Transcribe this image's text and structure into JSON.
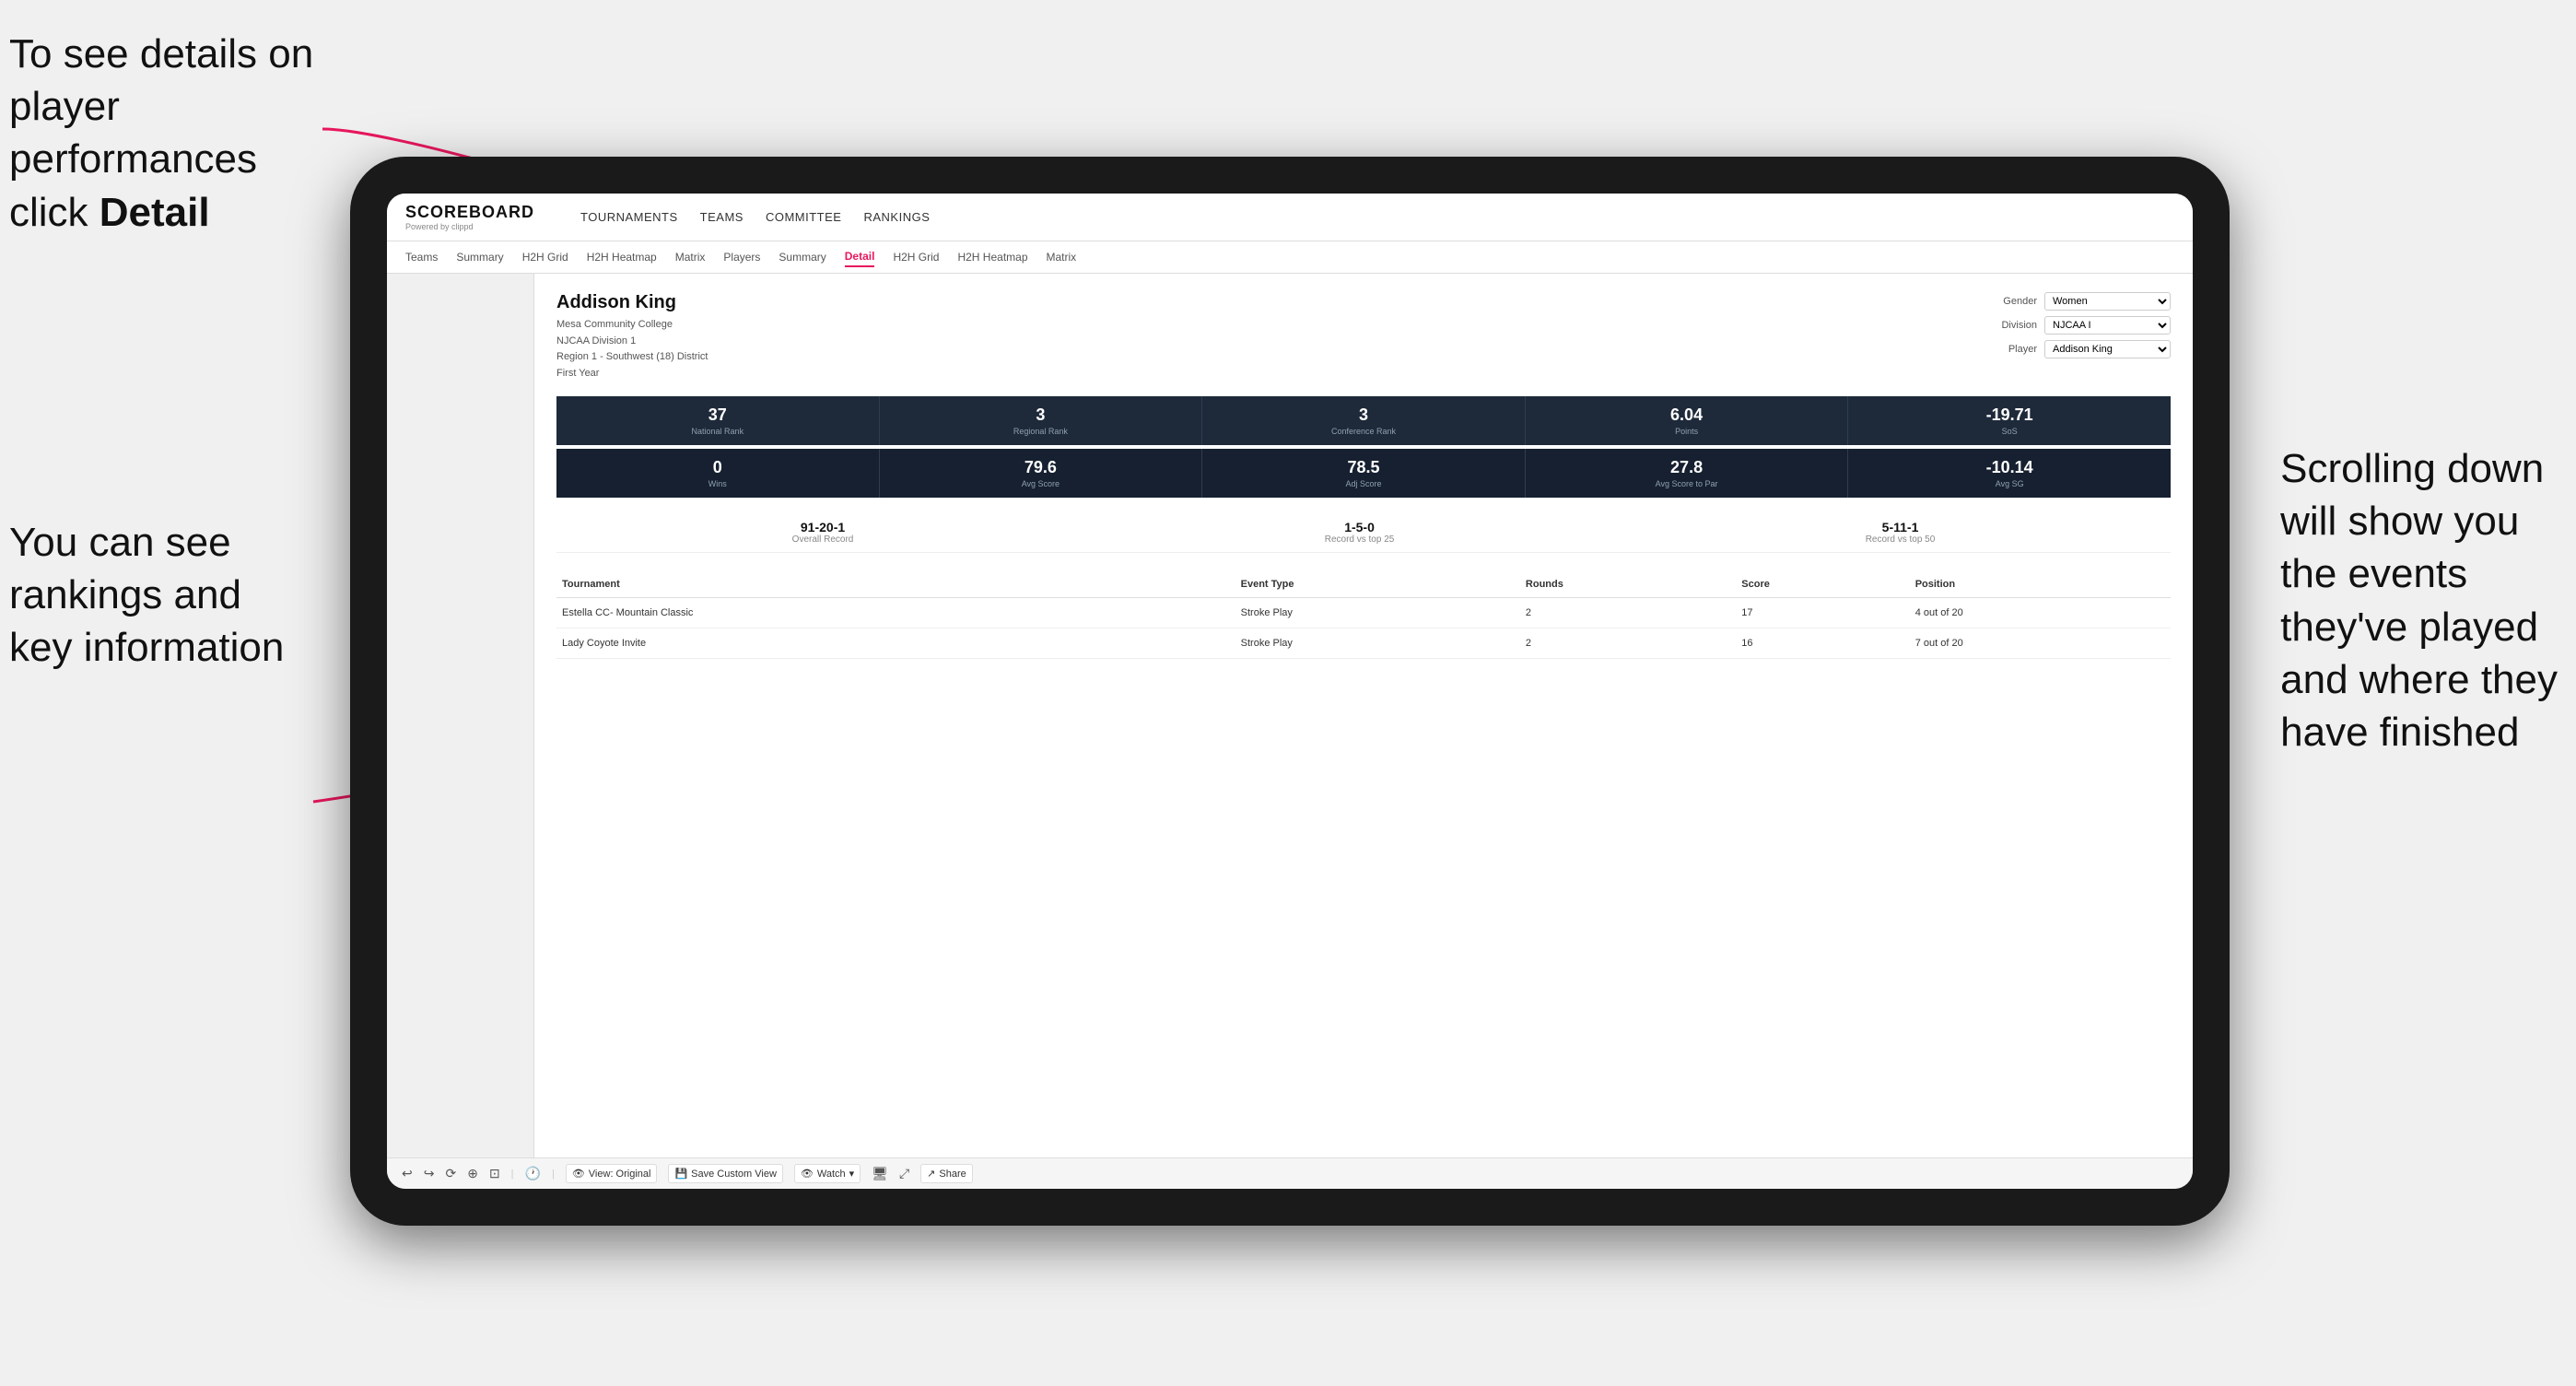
{
  "annotations": {
    "top_left": "To see details on player performances click ",
    "top_left_bold": "Detail",
    "bottom_left_line1": "You can see",
    "bottom_left_line2": "rankings and",
    "bottom_left_line3": "key information",
    "right_line1": "Scrolling down",
    "right_line2": "will show you",
    "right_line3": "the events",
    "right_line4": "they've played",
    "right_line5": "and where they",
    "right_line6": "have finished"
  },
  "header": {
    "logo_title": "SCOREBOARD",
    "logo_sub": "Powered by clippd",
    "nav_items": [
      {
        "label": "TOURNAMENTS",
        "active": false
      },
      {
        "label": "TEAMS",
        "active": false
      },
      {
        "label": "COMMITTEE",
        "active": false
      },
      {
        "label": "RANKINGS",
        "active": false
      }
    ]
  },
  "sub_nav": {
    "items": [
      {
        "label": "Teams",
        "active": false
      },
      {
        "label": "Summary",
        "active": false
      },
      {
        "label": "H2H Grid",
        "active": false
      },
      {
        "label": "H2H Heatmap",
        "active": false
      },
      {
        "label": "Matrix",
        "active": false
      },
      {
        "label": "Players",
        "active": false
      },
      {
        "label": "Summary",
        "active": false
      },
      {
        "label": "Detail",
        "active": true
      },
      {
        "label": "H2H Grid",
        "active": false
      },
      {
        "label": "H2H Heatmap",
        "active": false
      },
      {
        "label": "Matrix",
        "active": false
      }
    ]
  },
  "player": {
    "name": "Addison King",
    "school": "Mesa Community College",
    "division": "NJCAA Division 1",
    "region": "Region 1 - Southwest (18) District",
    "year": "First Year"
  },
  "controls": {
    "gender_label": "Gender",
    "gender_value": "Women",
    "division_label": "Division",
    "division_value": "NJCAA I",
    "player_label": "Player",
    "player_value": "Addison King"
  },
  "stats_row1": [
    {
      "value": "37",
      "label": "National Rank"
    },
    {
      "value": "3",
      "label": "Regional Rank"
    },
    {
      "value": "3",
      "label": "Conference Rank"
    },
    {
      "value": "6.04",
      "label": "Points"
    },
    {
      "value": "-19.71",
      "label": "SoS"
    }
  ],
  "stats_row2": [
    {
      "value": "0",
      "label": "Wins"
    },
    {
      "value": "79.6",
      "label": "Avg Score"
    },
    {
      "value": "78.5",
      "label": "Adj Score"
    },
    {
      "value": "27.8",
      "label": "Avg Score to Par"
    },
    {
      "value": "-10.14",
      "label": "Avg SG"
    }
  ],
  "records": [
    {
      "value": "91-20-1",
      "label": "Overall Record"
    },
    {
      "value": "1-5-0",
      "label": "Record vs top 25"
    },
    {
      "value": "5-11-1",
      "label": "Record vs top 50"
    }
  ],
  "table": {
    "headers": [
      "Tournament",
      "",
      "Event Type",
      "Rounds",
      "Score",
      "Position"
    ],
    "rows": [
      {
        "tournament": "Estella CC- Mountain Classic",
        "event_type": "Stroke Play",
        "rounds": "2",
        "score": "17",
        "position": "4 out of 20"
      },
      {
        "tournament": "Lady Coyote Invite",
        "event_type": "Stroke Play",
        "rounds": "2",
        "score": "16",
        "position": "7 out of 20"
      }
    ]
  },
  "toolbar": {
    "view_original": "View: Original",
    "save_custom": "Save Custom View",
    "watch": "Watch",
    "share": "Share"
  }
}
